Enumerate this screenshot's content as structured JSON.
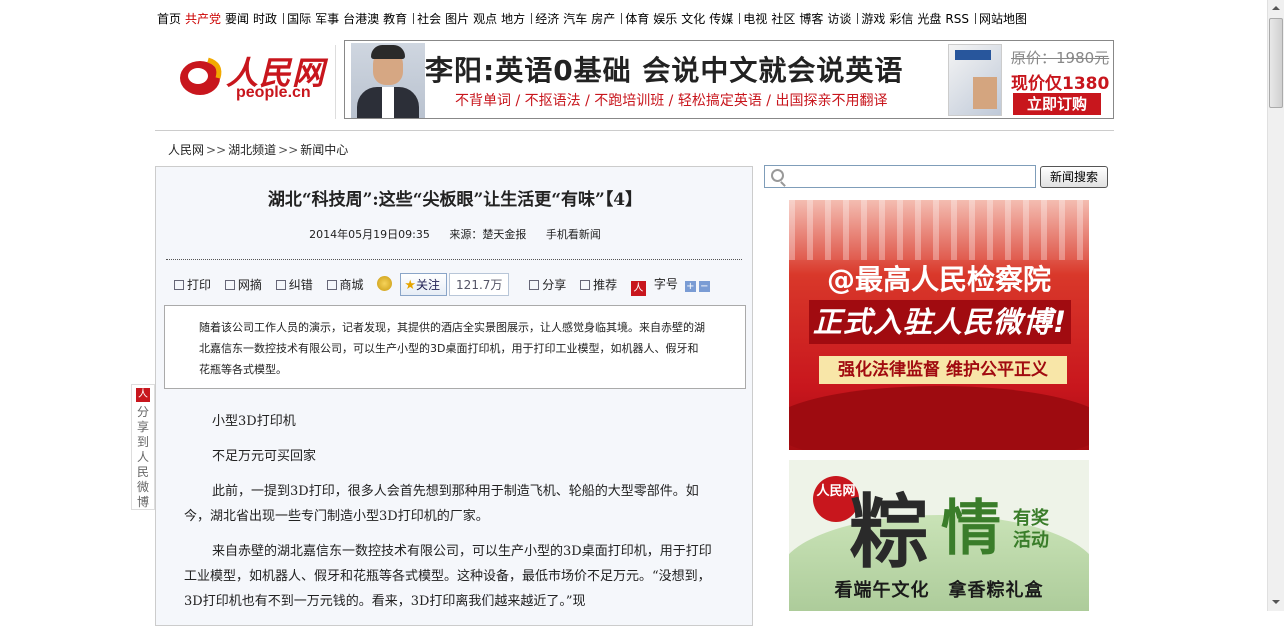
{
  "topnav": {
    "groups": [
      [
        "首页",
        "共产党",
        "要闻",
        "时政"
      ],
      [
        "国际",
        "军事",
        "台港澳",
        "教育"
      ],
      [
        "社会",
        "图片",
        "观点",
        "地方"
      ],
      [
        "经济",
        "汽车",
        "房产"
      ],
      [
        "体育",
        "娱乐",
        "文化",
        "传媒"
      ],
      [
        "电视",
        "社区",
        "博客",
        "访谈"
      ],
      [
        "游戏",
        "彩信",
        "光盘",
        "RSS"
      ],
      [
        "网站地图"
      ]
    ],
    "highlight": "共产党"
  },
  "logo": {
    "cn": "人民网",
    "en": "people.cn"
  },
  "ad": {
    "headline": "李阳:英语0基础 会说中文就会说英语",
    "tags": "不背单词 / 不抠语法 / 不跑培训班 / 轻松搞定英语 / 出国探亲不用翻译",
    "original_price": "原价：1980元",
    "current_price": "现价仅1380",
    "buy_label": "立即订购"
  },
  "breadcrumb": [
    "人民网",
    "湖北频道",
    "新闻中心"
  ],
  "article": {
    "title": "湖北“科技周”:这些“尖板眼”让生活更“有味”【4】",
    "date": "2014年05月19日09:35",
    "source": "来源：楚天金报",
    "mobile": "手机看新闻",
    "toolbar": {
      "print": "打印",
      "web": "网摘",
      "error": "纠错",
      "biz": "商城",
      "follow": "关注",
      "followers": "121.7万",
      "share": "分享",
      "recommend": "推荐",
      "font": "字号",
      "plus": "+",
      "minus": "−"
    },
    "summary": "随着该公司工作人员的演示，记者发现，其提供的酒店全实景图展示，让人感觉身临其境。来自赤壁的湖北嘉信东一数控技术有限公司，可以生产小型的3D桌面打印机，用于打印工业模型，如机器人、假牙和花瓶等各式模型。",
    "paragraphs": [
      "小型3D打印机",
      "不足万元可买回家",
      "此前，一提到3D打印，很多人会首先想到那种用于制造飞机、轮船的大型零部件。如今，湖北省出现一些专门制造小型3D打印机的厂家。",
      "来自赤壁的湖北嘉信东一数控技术有限公司，可以生产小型的3D桌面打印机，用于打印工业模型，如机器人、假牙和花瓶等各式模型。这种设备，最低市场价不足万元。“没想到，3D打印机也有不到一万元钱的。看来，3D打印离我们越来越近了。”现"
    ]
  },
  "share_sidebar": {
    "icon": "人",
    "label": "分享到人民微博"
  },
  "search": {
    "placeholder": "",
    "button": "新闻搜索"
  },
  "banner1": {
    "line1": "@最高人民检察院",
    "line2": "正式入驻人民微博!",
    "line3": "强化法律监督 维护公平正义"
  },
  "banner2": {
    "badge": "人民网",
    "char1": "粽",
    "char2": "情",
    "side": "有奖活动",
    "bottom": "看端午文化　拿香粽礼盒"
  },
  "colors": {
    "brand_red": "#c8161d",
    "nav_highlight": "#cc0000"
  }
}
